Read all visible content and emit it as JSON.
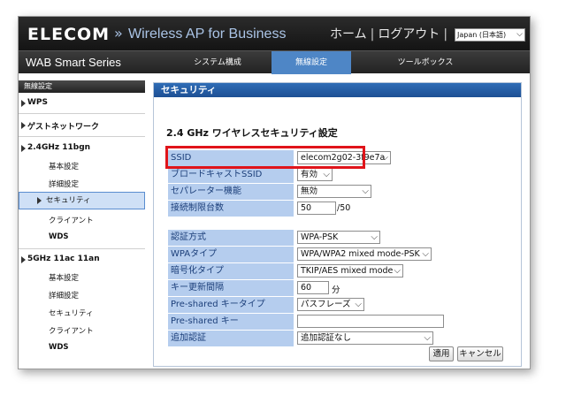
{
  "header": {
    "logo": "ELECOM",
    "chevron": "»",
    "product": "Wireless AP for Business",
    "home": "ホーム",
    "logout": "ログアウト",
    "separator": "|",
    "language": "Japan (日本語)"
  },
  "nav": {
    "series": "WAB Smart Series",
    "tabs": [
      {
        "label": "システム構成"
      },
      {
        "label": "無線設定",
        "active": true
      },
      {
        "label": "ツールボックス"
      }
    ]
  },
  "sidebar": {
    "title": "無線設定",
    "items": [
      {
        "label": "WPS"
      },
      {
        "label": "ゲストネットワーク"
      },
      {
        "label": "2.4GHz 11bgn"
      },
      {
        "label": "基本設定"
      },
      {
        "label": "詳細設定"
      },
      {
        "label": "セキュリティ",
        "active": true
      },
      {
        "label": "クライアント"
      },
      {
        "label": "WDS"
      },
      {
        "label": "5GHz 11ac 11an"
      },
      {
        "label": "基本設定"
      },
      {
        "label": "詳細設定"
      },
      {
        "label": "セキュリティ"
      },
      {
        "label": "クライアント"
      },
      {
        "label": "WDS"
      }
    ]
  },
  "main": {
    "heading": "セキュリティ",
    "section_title": "2.4 GHz ワイヤレスセキュリティ設定",
    "ssid": {
      "label": "SSID",
      "value": "elecom2g02-3f9e7a"
    },
    "broadcast_ssid": {
      "label": "ブロードキャストSSID",
      "value": "有効"
    },
    "separator": {
      "label": "セパレーター機能",
      "value": "無効"
    },
    "max_clients": {
      "label": "接続制限台数",
      "value": "50",
      "suffix": "/50"
    },
    "auth_method": {
      "label": "認証方式",
      "value": "WPA-PSK"
    },
    "wpa_type": {
      "label": "WPAタイプ",
      "value": "WPA/WPA2 mixed mode-PSK"
    },
    "cipher_type": {
      "label": "暗号化タイプ",
      "value": "TKIP/AES mixed mode"
    },
    "key_renewal": {
      "label": "キー更新間隔",
      "value": "60",
      "unit": "分"
    },
    "psk_type": {
      "label": "Pre-shared キータイプ",
      "value": "パスフレーズ"
    },
    "psk": {
      "label": "Pre-shared キー",
      "value": ""
    },
    "extra_auth": {
      "label": "追加認証",
      "value": "追加認証なし"
    },
    "apply_button": "適用",
    "cancel_button": "キャンセル"
  },
  "icons": {
    "dropdown": "chevron-down-icon",
    "sidebar_marker": "triangle-right-icon"
  },
  "colors": {
    "nav_active": "#4e86c6",
    "label_bg": "#b5cdee",
    "highlight": "#e0141a",
    "header_bar": "#2f6db6"
  }
}
